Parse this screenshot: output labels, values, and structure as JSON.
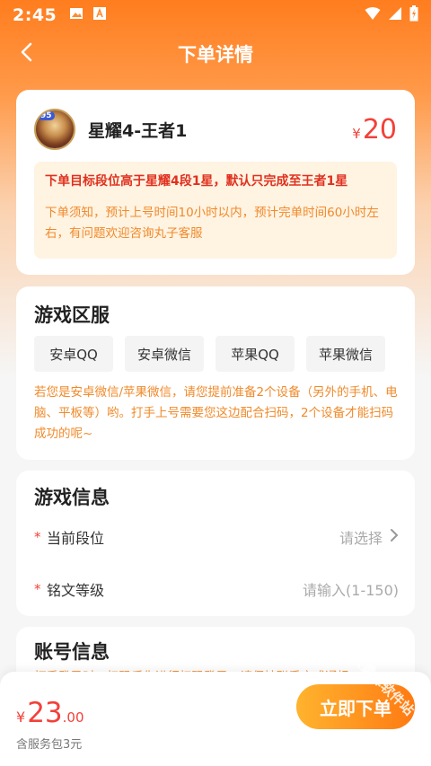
{
  "status_bar": {
    "time": "2:45"
  },
  "nav": {
    "title": "下单详情"
  },
  "product": {
    "name": "星耀4-王者1",
    "avatar_badge": "95",
    "price_symbol": "¥",
    "price": "20"
  },
  "notice": {
    "main": "下单目标段位高于星耀4段1星，默认只完成至王者1星",
    "sub": "下单须知，预计上号时间10小时以内，预计完单时间60小时左右，有问题欢迎咨询丸子客服"
  },
  "server": {
    "title": "游戏区服",
    "options": [
      "安卓QQ",
      "安卓微信",
      "苹果QQ",
      "苹果微信"
    ],
    "tip": "若您是安卓微信/苹果微信，请您提前准备2个设备（另外的手机、电脑、平板等）哟。打手上号需要您这边配合扫码，2个设备才能扫码成功的呢~"
  },
  "game_info": {
    "title": "游戏信息",
    "required_mark": "*",
    "rank_label": "当前段位",
    "rank_placeholder": "请选择",
    "rune_label": "铭文等级",
    "rune_placeholder": "请输入(1-150)"
  },
  "account": {
    "title": "账号信息",
    "tip": "打手登录时，扫码后你进行扫码登录，请保持联系方式通畅"
  },
  "bottom": {
    "total_symbol": "¥",
    "total_int": "23",
    "total_dec": ".00",
    "service_fee": "含服务包3元",
    "order_button": "立即下单",
    "watermark": "大黄蜂软件站"
  },
  "colors": {
    "accent": "#ff7d1e",
    "price_red": "#f2413a",
    "tip_orange": "#f08a2a",
    "notice_bg": "#fff3e2"
  }
}
